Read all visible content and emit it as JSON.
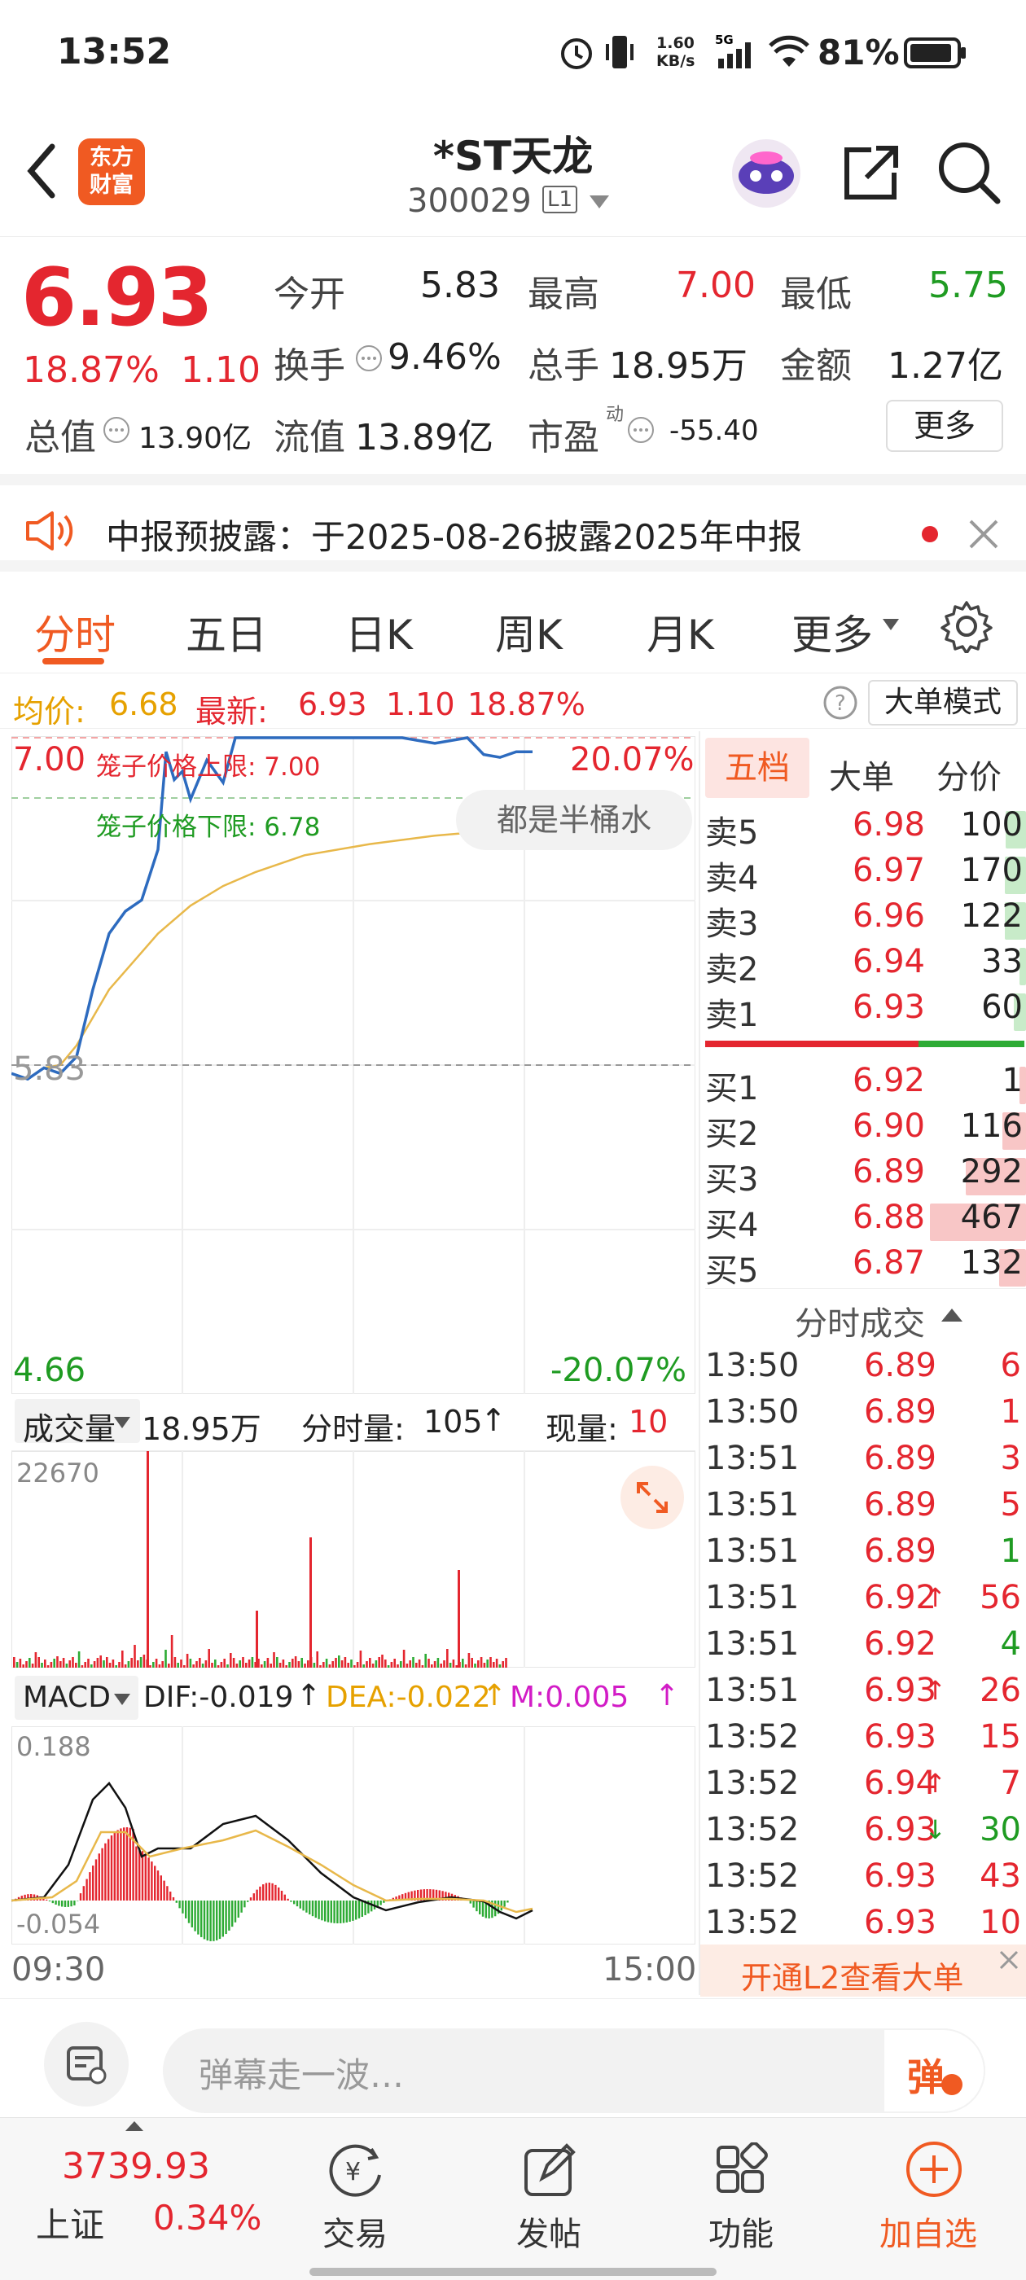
{
  "status": {
    "time": "13:52",
    "speed": "1.60\nKB/s",
    "battery": "81%"
  },
  "nav": {
    "logo_line1": "东方",
    "logo_line2": "财富",
    "stock_name": "*ST天龙",
    "stock_code": "300029",
    "level": "L1"
  },
  "quote": {
    "price": "6.93",
    "change_pct": "18.87%",
    "change": "1.10",
    "open_label": "今开",
    "open": "5.83",
    "high_label": "最高",
    "high": "7.00",
    "low_label": "最低",
    "low": "5.75",
    "turnover_label": "换手",
    "turnover": "9.46%",
    "volume_label": "总手",
    "volume": "18.95万",
    "amount_label": "金额",
    "amount": "1.27亿",
    "mcap_label": "总值",
    "mcap": "13.90亿",
    "float_label": "流值",
    "float": "13.89亿",
    "pe_label": "市盈",
    "pe_sup": "动",
    "pe": "-55.40",
    "more": "更多"
  },
  "notice": {
    "text": "中报预披露：于2025-08-26披露2025年中报"
  },
  "tabs": [
    "分时",
    "五日",
    "日K",
    "周K",
    "月K",
    "更多"
  ],
  "avg": {
    "label": "均价:",
    "value": "6.68",
    "latest_label": "最新:",
    "latest": "6.93",
    "change": "1.10",
    "pct": "18.87%",
    "mode": "大单模式"
  },
  "chart": {
    "upper_price": "7.00",
    "upper_pct": "20.07%",
    "lower_price": "4.66",
    "lower_pct": "-20.07%",
    "open_mark": "5.83",
    "cage_upper": "笼子价格上限: 7.00",
    "cage_lower": "笼子价格下限: 6.78",
    "bubble": "都是半桶水",
    "time_start": "09:30",
    "time_end": "15:00"
  },
  "volume": {
    "label": "成交量",
    "total": "18.95万",
    "per_min_label": "分时量:",
    "per_min": "105",
    "current_label": "现量:",
    "current": "10",
    "max": "22670"
  },
  "macd": {
    "label": "MACD",
    "dif": "DIF:-0.019",
    "dea": "DEA:-0.022",
    "m": "M:0.005",
    "max": "0.188",
    "min": "-0.054"
  },
  "orderbook": {
    "tabs": [
      "五档",
      "大单",
      "分价"
    ],
    "asks": [
      {
        "label": "卖5",
        "price": "6.98",
        "qty": "100"
      },
      {
        "label": "卖4",
        "price": "6.97",
        "qty": "170"
      },
      {
        "label": "卖3",
        "price": "6.96",
        "qty": "122"
      },
      {
        "label": "卖2",
        "price": "6.94",
        "qty": "33"
      },
      {
        "label": "卖1",
        "price": "6.93",
        "qty": "60"
      }
    ],
    "bids": [
      {
        "label": "买1",
        "price": "6.92",
        "qty": "1"
      },
      {
        "label": "买2",
        "price": "6.90",
        "qty": "116"
      },
      {
        "label": "买3",
        "price": "6.89",
        "qty": "292"
      },
      {
        "label": "买4",
        "price": "6.88",
        "qty": "467"
      },
      {
        "label": "买5",
        "price": "6.87",
        "qty": "132"
      }
    ]
  },
  "trades": {
    "title": "分时成交",
    "rows": [
      {
        "t": "13:50",
        "p": "6.89",
        "a": "",
        "v": "6",
        "c": "red"
      },
      {
        "t": "13:50",
        "p": "6.89",
        "a": "",
        "v": "1",
        "c": "red"
      },
      {
        "t": "13:51",
        "p": "6.89",
        "a": "",
        "v": "3",
        "c": "red"
      },
      {
        "t": "13:51",
        "p": "6.89",
        "a": "",
        "v": "5",
        "c": "red"
      },
      {
        "t": "13:51",
        "p": "6.89",
        "a": "",
        "v": "1",
        "c": "green"
      },
      {
        "t": "13:51",
        "p": "6.92",
        "a": "↑",
        "v": "56",
        "c": "red"
      },
      {
        "t": "13:51",
        "p": "6.92",
        "a": "",
        "v": "4",
        "c": "green"
      },
      {
        "t": "13:51",
        "p": "6.93",
        "a": "↑",
        "v": "26",
        "c": "red"
      },
      {
        "t": "13:52",
        "p": "6.93",
        "a": "",
        "v": "15",
        "c": "red"
      },
      {
        "t": "13:52",
        "p": "6.94",
        "a": "↑",
        "v": "7",
        "c": "red"
      },
      {
        "t": "13:52",
        "p": "6.93",
        "a": "↓",
        "v": "30",
        "c": "green"
      },
      {
        "t": "13:52",
        "p": "6.93",
        "a": "",
        "v": "43",
        "c": "red"
      },
      {
        "t": "13:52",
        "p": "6.93",
        "a": "",
        "v": "10",
        "c": "red"
      }
    ],
    "l2": "开通L2查看大单"
  },
  "input": {
    "placeholder": "弹幕走一波…",
    "send": "弹"
  },
  "bottom": {
    "index_value": "3739.93",
    "index_name": "上证",
    "index_pct": "0.34%",
    "items": [
      "交易",
      "发帖",
      "功能",
      "加自选"
    ]
  }
}
